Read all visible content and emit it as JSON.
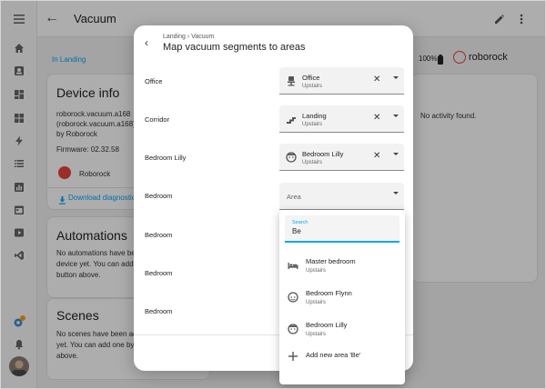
{
  "app": {
    "page_title": "Vacuum",
    "area_link": "In Landing",
    "battery": "100%",
    "brand": "roborock"
  },
  "device_info": {
    "title": "Device info",
    "line1": "roborock.vacuum.a168",
    "line2": "(roborock.vacuum.a168)",
    "line3": "by Roborock",
    "firmware": "Firmware: 02.32.58",
    "integration": "Roborock",
    "download": "Download diagnostics"
  },
  "automations": {
    "title": "Automations",
    "line1": "No automations have been",
    "line2": "device yet. You can add on",
    "line3": "button above."
  },
  "scenes": {
    "title": "Scenes",
    "line1": "No scenes have been add",
    "line2": "yet. You can add one by pr",
    "line3": "above."
  },
  "activity": {
    "empty": "No activity found."
  },
  "dialog": {
    "breadcrumb_1": "Landing",
    "breadcrumb_sep": "›",
    "breadcrumb_2": "Vacuum",
    "title": "Map vacuum segments to areas",
    "rows": [
      {
        "label": "Office",
        "area": "Office",
        "floor": "Upstairs",
        "icon": "office-chair-icon"
      },
      {
        "label": "Corridor",
        "area": "Landing",
        "floor": "Upstairs",
        "icon": "stairs-icon"
      },
      {
        "label": "Bedroom Lilly",
        "area": "Bedroom Lilly",
        "floor": "Upstairs",
        "icon": "face-icon"
      },
      {
        "label": "Bedroom",
        "placeholder": "Area"
      },
      {
        "label": "Bedroom"
      },
      {
        "label": "Bedroom"
      },
      {
        "label": "Bedroom"
      }
    ]
  },
  "dropdown": {
    "search_label": "Search",
    "search_value": "Be",
    "options": [
      {
        "name": "Master bedroom",
        "floor": "Upstairs",
        "icon": "bed-icon"
      },
      {
        "name": "Bedroom Flynn",
        "floor": "Upstairs",
        "icon": "face-icon"
      },
      {
        "name": "Bedroom Lilly",
        "floor": "Upstairs",
        "icon": "face-icon"
      },
      {
        "name": "Add new area 'Be'",
        "icon": "plus-icon"
      }
    ]
  },
  "colors": {
    "accent": "#03a9f4",
    "brand_red": "#e8433a",
    "badge": "#ffa000"
  }
}
